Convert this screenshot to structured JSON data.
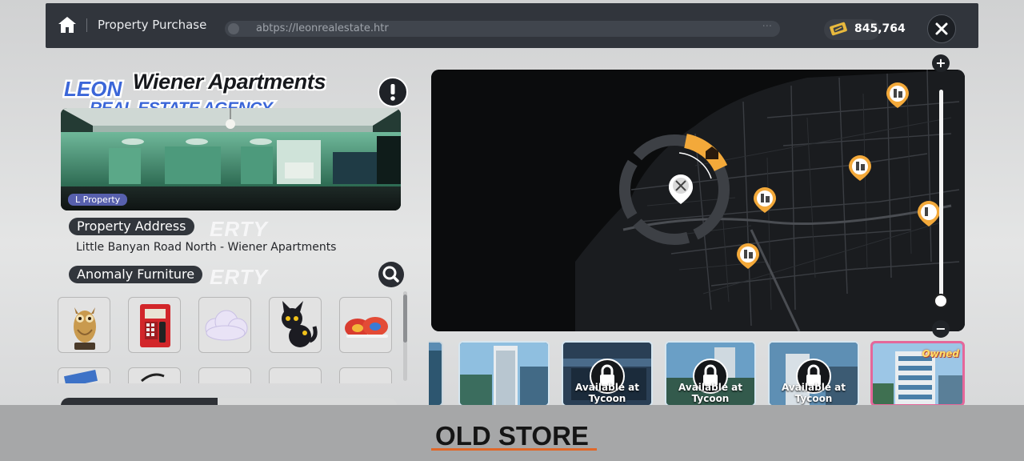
{
  "topbar": {
    "title": "Property Purchase",
    "url": "abtps://leonrealestate.htr",
    "url_more": "···",
    "currency": "845,764",
    "home_icon": "home-icon",
    "close_icon": "close-icon"
  },
  "property": {
    "agency_line1": "LEON",
    "agency_line2": "REAL ESTATE AGENCY",
    "name": "Wiener Apartments",
    "tag": "L Property",
    "address_label": "Property Address",
    "address": "Little Banyan Road North - Wiener Apartments",
    "furniture_label": "Anomaly Furniture",
    "ghost_text": "ERTY"
  },
  "furniture": [
    "owl-statue",
    "red-payphone",
    "cloud-cushion",
    "black-cat-figure",
    "red-sneakers"
  ],
  "map": {
    "pins": [
      "house-pin-selected",
      "anomaly-pin",
      "building-pin",
      "building-pin",
      "building-pin",
      "building-pin",
      "building-pin"
    ],
    "zoom_plus": "+",
    "zoom_minus": "−",
    "zoom_level": 0.05
  },
  "thumbnails": [
    {
      "label": ""
    },
    {
      "label": ""
    },
    {
      "label": "Available at Tycoon"
    },
    {
      "label": "Available at Tycoon"
    },
    {
      "label": "Available at Tycoon"
    },
    {
      "label": "Owned"
    }
  ],
  "caption": "OLD STORE",
  "colors": {
    "accent": "#f3a93a",
    "topbar": "#31353c",
    "owned_border": "#e5679a",
    "caption_underline": "#e0682a"
  }
}
